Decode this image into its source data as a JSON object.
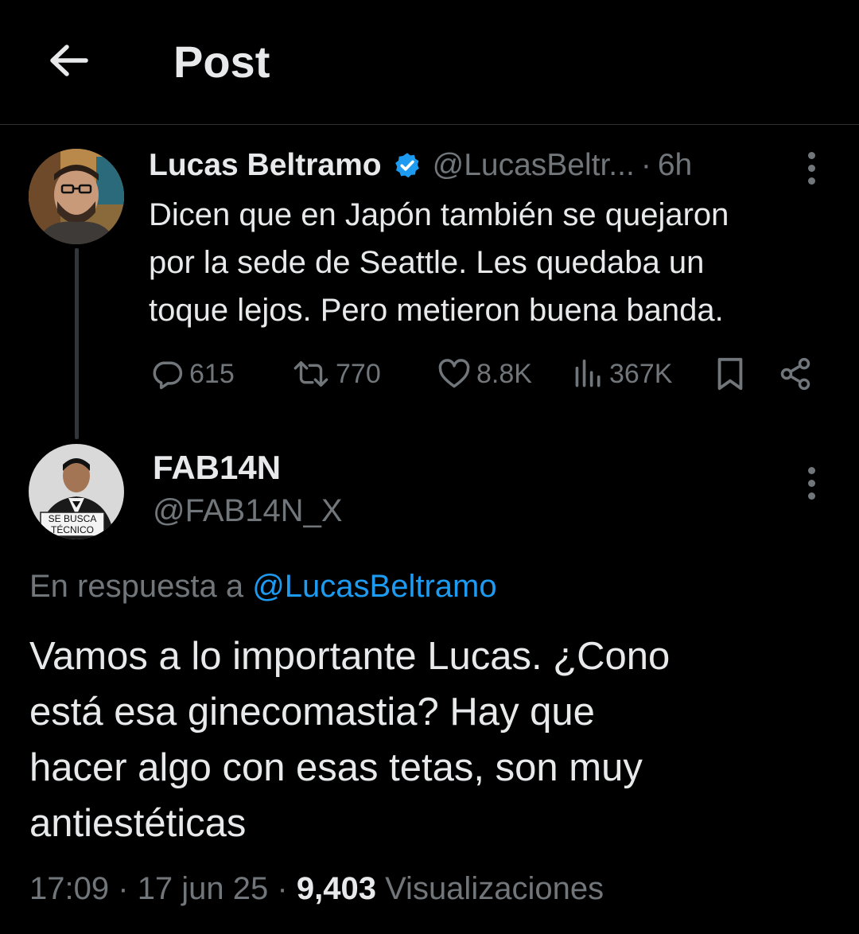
{
  "header": {
    "title": "Post"
  },
  "parent_post": {
    "author_name": "Lucas Beltramo",
    "author_handle": "@LucasBeltr...",
    "separator": "·",
    "time_ago": "6h",
    "text_lines": [
      "Dicen que en Japón también se quejaron",
      "por la sede de Seattle. Les quedaba un",
      "toque lejos. Pero metieron buena banda."
    ],
    "actions": {
      "replies": "615",
      "reposts": "770",
      "likes": "8.8K",
      "views": "367K"
    }
  },
  "reply_post": {
    "author_name": "FAB14N",
    "author_handle": "@FAB14N_X",
    "avatar_sign_lines": [
      "SE BUSCA",
      "TÉCNICO"
    ],
    "reply_to_label": "En respuesta a",
    "reply_to_handle": "@LucasBeltramo",
    "text_lines": [
      "Vamos a lo importante Lucas. ¿Cono",
      "está esa ginecomastia? Hay que",
      "hacer algo con esas tetas, son muy",
      "antiestéticas"
    ],
    "time": "17:09",
    "date": "17 jun 25",
    "separator": "·",
    "views_count": "9,403",
    "views_label": "Visualizaciones"
  },
  "colors": {
    "background": "#000000",
    "text_primary": "#e7e9ea",
    "text_secondary": "#71767b",
    "accent_blue": "#1d9bf0",
    "divider": "#2f3336"
  },
  "icons": {
    "back": "arrow-left-icon",
    "verified": "verified-badge-icon",
    "more": "more-vertical-icon",
    "reply": "reply-bubble-icon",
    "repost": "repost-icon",
    "like": "heart-icon",
    "views": "views-bar-icon",
    "bookmark": "bookmark-icon",
    "share": "share-icon"
  }
}
